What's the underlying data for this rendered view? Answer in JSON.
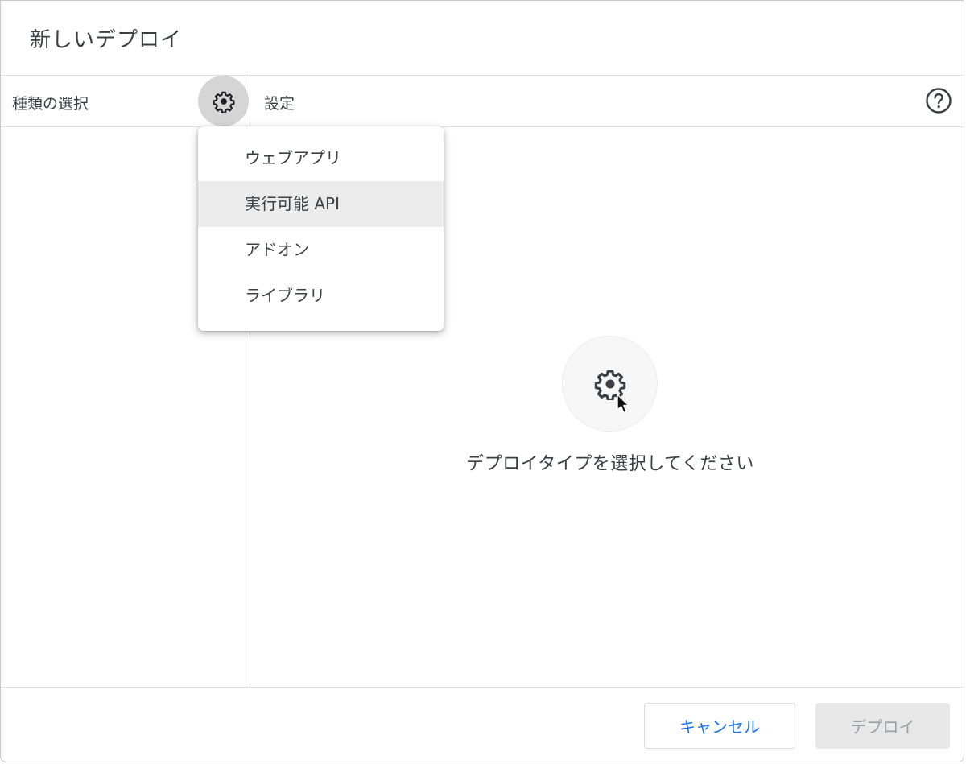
{
  "dialog": {
    "title": "新しいデプロイ"
  },
  "header": {
    "type_label": "種類の選択",
    "settings_label": "設定",
    "gear_icon": "gear-icon",
    "help_icon": "help-circle-icon"
  },
  "menu": {
    "items": [
      {
        "label": "ウェブアプリ",
        "hovered": false
      },
      {
        "label": "実行可能 API",
        "hovered": true
      },
      {
        "label": "アドオン",
        "hovered": false
      },
      {
        "label": "ライブラリ",
        "hovered": false
      }
    ]
  },
  "empty_state": {
    "icon": "gear-icon",
    "message": "デプロイタイプを選択してください"
  },
  "footer": {
    "cancel_label": "キャンセル",
    "deploy_label": "デプロイ",
    "deploy_disabled": true
  },
  "colors": {
    "accent": "#1a73e8",
    "text": "#3c4043",
    "disabled_bg": "#e8e8e8",
    "disabled_text": "#9aa0a6",
    "hover_bg": "#ececec"
  }
}
